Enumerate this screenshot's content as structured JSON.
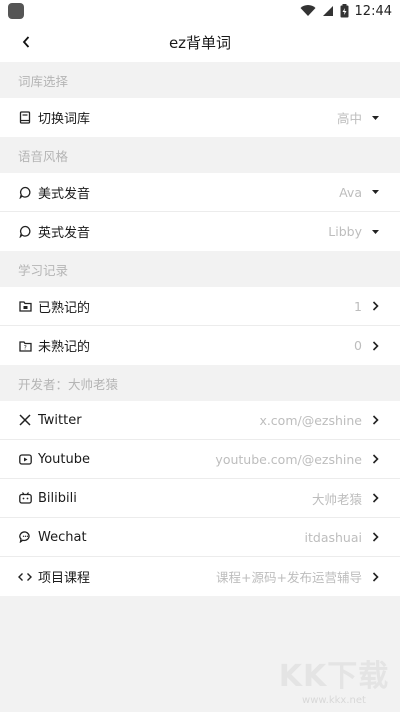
{
  "status": {
    "time": "12:44"
  },
  "appbar": {
    "title": "ez背单词"
  },
  "sections": {
    "library": {
      "header": "词库选择",
      "switch_label": "切换词库",
      "switch_value": "高中"
    },
    "voice": {
      "header": "语音风格",
      "us_label": "美式发音",
      "us_value": "Ava",
      "uk_label": "英式发音",
      "uk_value": "Libby"
    },
    "record": {
      "header": "学习记录",
      "known_label": "已熟记的",
      "known_value": "1",
      "unknown_label": "未熟记的",
      "unknown_value": "0"
    },
    "developer": {
      "header": "开发者：大帅老猿",
      "twitter_label": "Twitter",
      "twitter_value": "x.com/@ezshine",
      "youtube_label": "Youtube",
      "youtube_value": "youtube.com/@ezshine",
      "bilibili_label": "Bilibili",
      "bilibili_value": "大帅老猿",
      "wechat_label": "Wechat",
      "wechat_value": "itdashuai",
      "course_label": "项目课程",
      "course_value": "课程+源码+发布运营辅导"
    }
  },
  "watermark": {
    "big": "KK下载",
    "small": "www.kkx.net"
  }
}
